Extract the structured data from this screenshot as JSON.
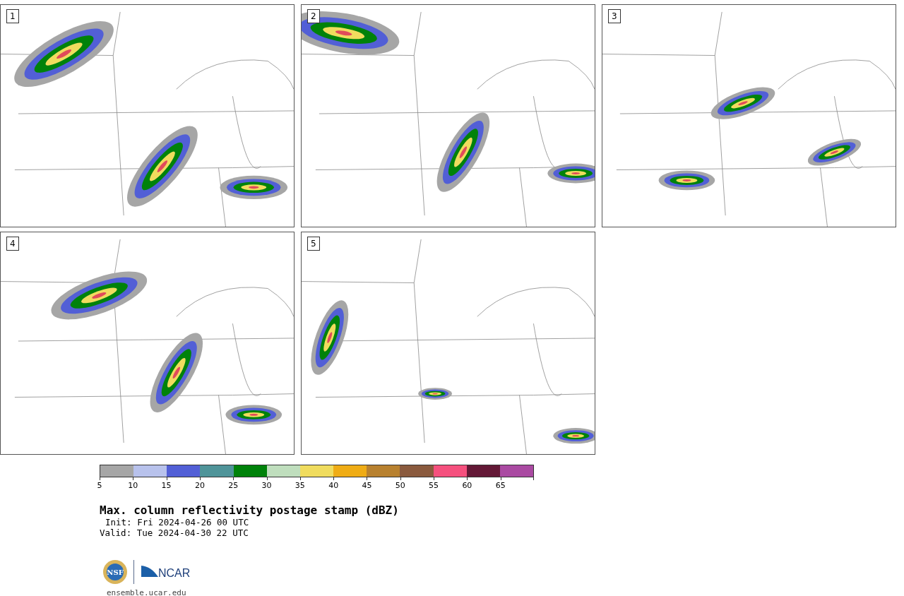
{
  "panels": [
    {
      "label": "1"
    },
    {
      "label": "2"
    },
    {
      "label": "3"
    },
    {
      "label": "4"
    },
    {
      "label": "5"
    }
  ],
  "colorbar": {
    "bins": [
      {
        "color": "#a6a6a6"
      },
      {
        "color": "#b8c2ec"
      },
      {
        "color": "#525fd6"
      },
      {
        "color": "#4f9499"
      },
      {
        "color": "#00820a"
      },
      {
        "color": "#bfdebd"
      },
      {
        "color": "#f0dc5e"
      },
      {
        "color": "#efac15"
      },
      {
        "color": "#b8812f"
      },
      {
        "color": "#8a5a3e"
      },
      {
        "color": "#f5507e"
      },
      {
        "color": "#631836"
      },
      {
        "color": "#aa4aa2"
      }
    ],
    "ticks": [
      "5",
      "10",
      "15",
      "20",
      "25",
      "30",
      "35",
      "40",
      "45",
      "50",
      "55",
      "60",
      "65"
    ]
  },
  "title": "Max. column reflectivity postage stamp (dBZ)",
  "init": "Init: Fri 2024-04-26 00 UTC",
  "valid": "Valid: Tue 2024-04-30 22 UTC",
  "logos": {
    "nsf": "NSF",
    "ncar": "NCAR"
  },
  "link": "ensemble.ucar.edu"
}
